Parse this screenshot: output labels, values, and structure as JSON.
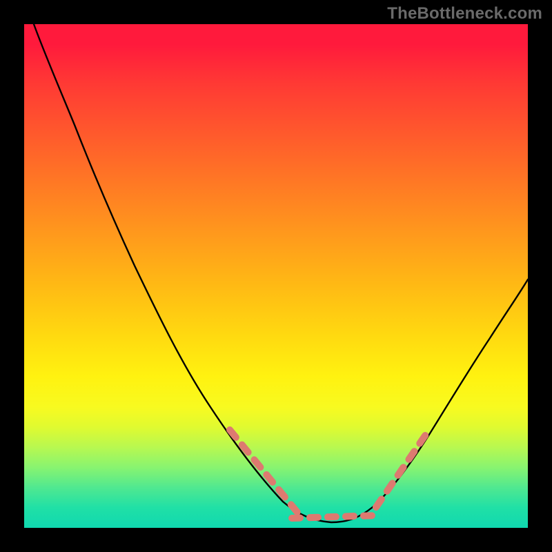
{
  "watermark": "TheBottleneck.com",
  "colors": {
    "frame": "#000000",
    "curve": "#000000",
    "dots": "#dd7a70",
    "gradient_top": "#ff1a3c",
    "gradient_bottom": "#10d8b0"
  },
  "chart_data": {
    "type": "line",
    "title": "",
    "xlabel": "",
    "ylabel": "",
    "xlim": [
      0,
      100
    ],
    "ylim": [
      0,
      100
    ],
    "grid": false,
    "legend": false,
    "x": [
      2,
      6,
      10,
      14,
      18,
      22,
      26,
      30,
      34,
      38,
      42,
      46,
      50,
      54,
      58,
      62,
      66,
      70,
      74,
      78,
      82,
      86,
      90,
      94,
      98
    ],
    "values": [
      100,
      94,
      86,
      78,
      70,
      62,
      54,
      46,
      38,
      31,
      24,
      18,
      12,
      7,
      4,
      2,
      2,
      4,
      8,
      14,
      22,
      30,
      38,
      45,
      52
    ],
    "annotations": [
      {
        "note": "salmon dotted overlay on left descending branch",
        "x_range": [
          40,
          55
        ],
        "y_range": [
          25,
          6
        ]
      },
      {
        "note": "salmon dotted overlay across trough",
        "x_range": [
          52,
          70
        ],
        "y_range": [
          4,
          4
        ]
      },
      {
        "note": "salmon dotted overlay on right ascending branch",
        "x_range": [
          70,
          80
        ],
        "y_range": [
          6,
          24
        ]
      }
    ]
  }
}
